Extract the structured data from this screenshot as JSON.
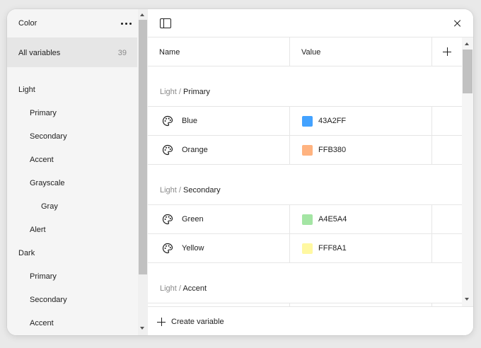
{
  "sidebar": {
    "title": "Color",
    "all_variables": {
      "label": "All variables",
      "count": "39"
    },
    "items": [
      {
        "label": "Light",
        "level": 0
      },
      {
        "label": "Primary",
        "level": 1
      },
      {
        "label": "Secondary",
        "level": 1
      },
      {
        "label": "Accent",
        "level": 1
      },
      {
        "label": "Grayscale",
        "level": 1
      },
      {
        "label": "Gray",
        "level": 2
      },
      {
        "label": "Alert",
        "level": 1
      },
      {
        "label": "Dark",
        "level": 0
      },
      {
        "label": "Primary",
        "level": 1
      },
      {
        "label": "Secondary",
        "level": 1
      },
      {
        "label": "Accent",
        "level": 1
      }
    ]
  },
  "table": {
    "header": {
      "name": "Name",
      "value": "Value"
    },
    "groups": [
      {
        "prefix": "Light",
        "separator": "/",
        "name": "Primary",
        "rows": [
          {
            "name": "Blue",
            "value": "43A2FF",
            "color": "#43A2FF"
          },
          {
            "name": "Orange",
            "value": "FFB380",
            "color": "#FFB380"
          }
        ]
      },
      {
        "prefix": "Light",
        "separator": "/",
        "name": "Secondary",
        "rows": [
          {
            "name": "Green",
            "value": "A4E5A4",
            "color": "#A4E5A4"
          },
          {
            "name": "Yellow",
            "value": "FFF8A1",
            "color": "#FFF8A1"
          }
        ]
      },
      {
        "prefix": "Light",
        "separator": "/",
        "name": "Accent",
        "rows": []
      }
    ]
  },
  "footer": {
    "create_label": "Create variable"
  },
  "icons": {
    "more": "more-horizontal-icon",
    "panel": "sidebar-panel-icon",
    "close": "close-icon",
    "add": "plus-icon",
    "variable": "palette-icon"
  }
}
